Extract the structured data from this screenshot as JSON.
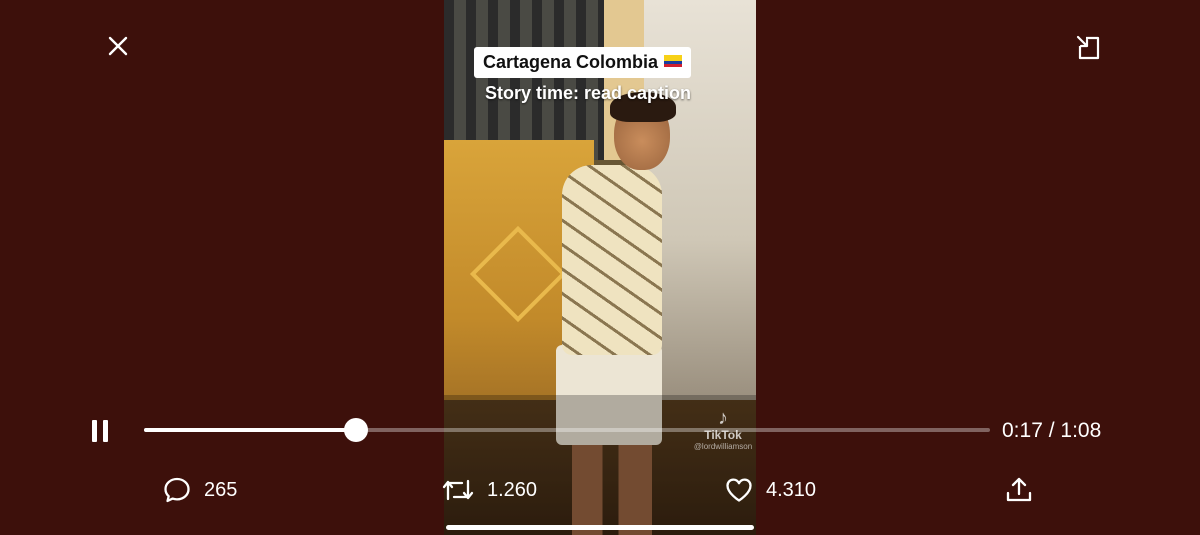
{
  "video": {
    "caption_title": "Cartagena Colombia",
    "caption_flag": "colombia-flag",
    "caption_subtitle": "Story time: read caption",
    "watermark_brand": "TikTok",
    "watermark_user": "@lordwilliamson"
  },
  "controls": {
    "close_icon": "close-icon",
    "pip_icon": "picture-in-picture-icon",
    "pause_icon": "pause-icon",
    "progress": {
      "current": "0:17",
      "separator": "/",
      "duration": "1:08",
      "played_fraction": 0.25
    }
  },
  "actions": {
    "comments": {
      "icon": "comment-icon",
      "count": "265"
    },
    "retweets": {
      "icon": "retweet-icon",
      "count": "1.260"
    },
    "likes": {
      "icon": "heart-icon",
      "count": "4.310"
    },
    "share": {
      "icon": "share-icon"
    }
  },
  "colors": {
    "background": "#3d100b",
    "foreground": "#ffffff"
  }
}
